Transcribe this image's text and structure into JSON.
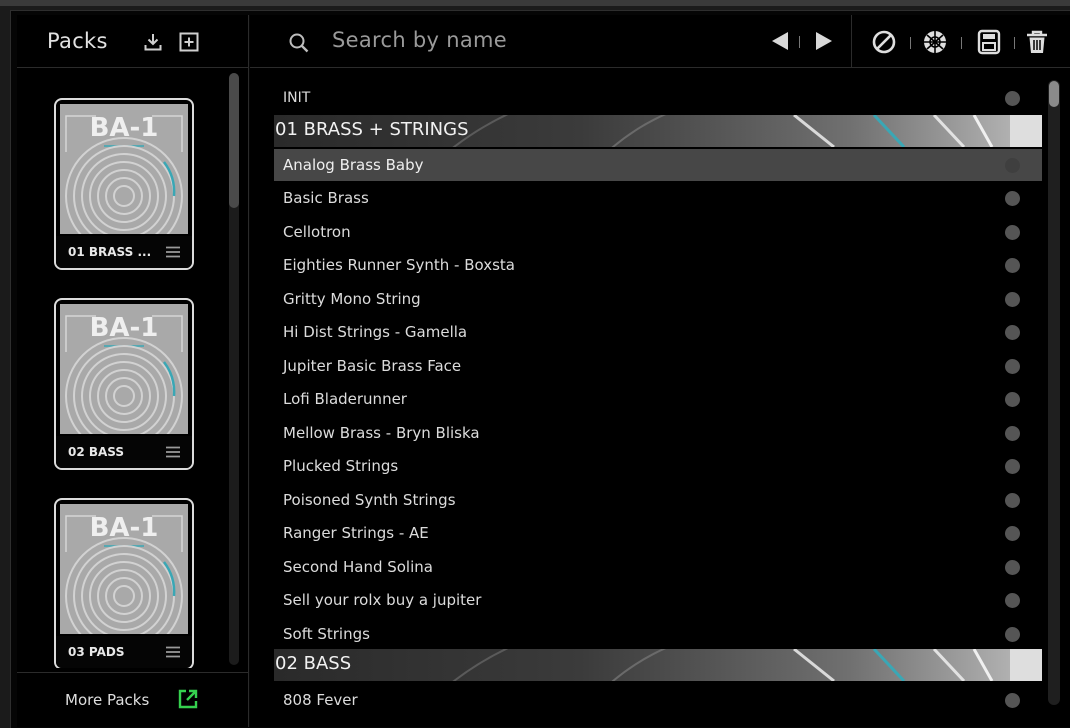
{
  "sidebar": {
    "title": "Packs",
    "more_packs_label": "More Packs",
    "icons": {
      "import": "download-icon",
      "add": "plus-box-icon",
      "open_external": "external-link-icon"
    },
    "packs": [
      {
        "logo": "BA-1",
        "name": "01 BRASS ..."
      },
      {
        "logo": "BA-1",
        "name": "02 BASS"
      },
      {
        "logo": "BA-1",
        "name": "03 PADS"
      }
    ]
  },
  "search": {
    "placeholder": "Search by name",
    "value": ""
  },
  "toolbar": {
    "icons": [
      "prev-icon",
      "next-icon",
      "clear-icon",
      "randomize-icon",
      "save-icon",
      "delete-icon"
    ]
  },
  "presets": {
    "init_label": "INIT",
    "banks": [
      {
        "name": "01 BRASS + STRINGS",
        "items": [
          "Analog Brass Baby",
          "Basic Brass",
          "Cellotron",
          "Eighties Runner Synth  - Boxsta",
          "Gritty Mono String",
          "Hi Dist Strings - Gamella",
          "Jupiter Basic Brass Face",
          "Lofi Bladerunner",
          "Mellow Brass - Bryn Bliska",
          "Plucked Strings",
          "Poisoned Synth Strings",
          "Ranger Strings - AE",
          "Second Hand Solina",
          "Sell your rolx buy a jupiter",
          "Soft Strings"
        ]
      },
      {
        "name": "02 BASS",
        "items": [
          "808 Fever"
        ]
      }
    ],
    "selected": "Analog Brass Baby"
  },
  "colors": {
    "background": "#000000",
    "selected_row": "#474747",
    "accent_teal": "#3aa7b5",
    "external_link": "#35d14e"
  }
}
